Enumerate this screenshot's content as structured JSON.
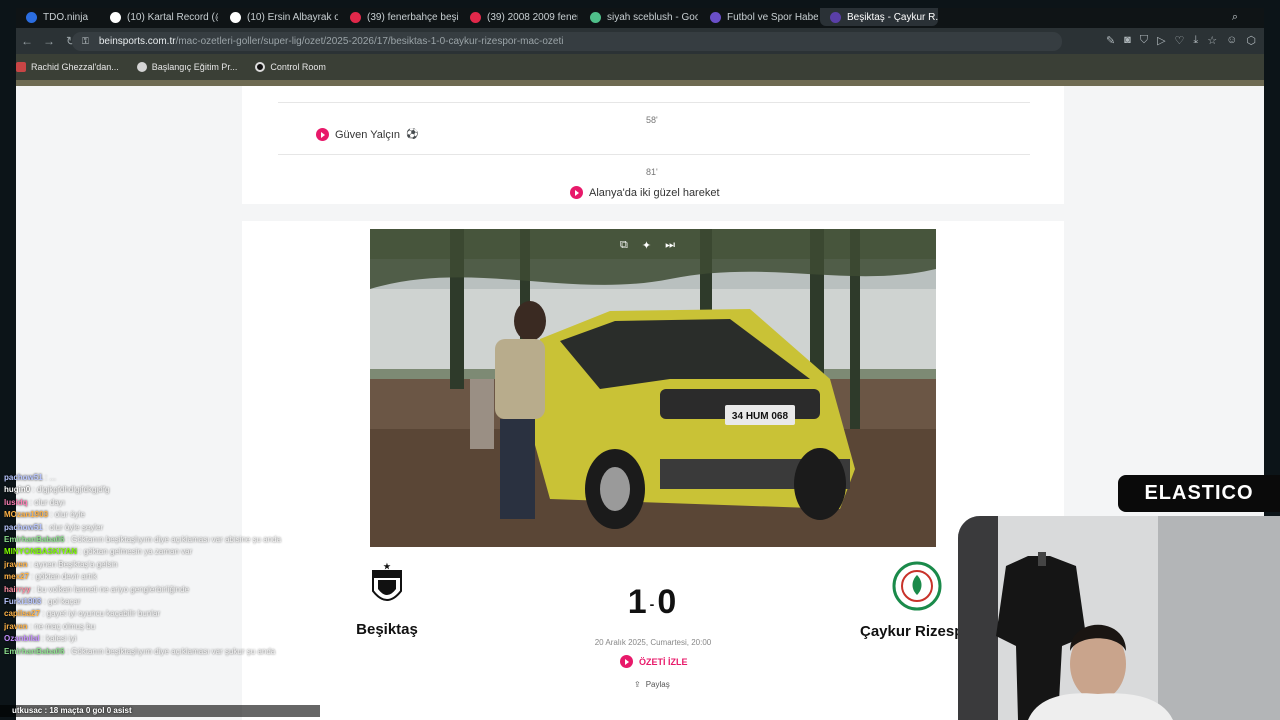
{
  "browser": {
    "tabs": [
      {
        "label": "TDO.ninja",
        "color": "#2b6de0",
        "active": false
      },
      {
        "label": "(10) Kartal Record (@K...",
        "color": "#ffffff",
        "active": false
      },
      {
        "label": "(10) Ersin Albayrak on X",
        "color": "#ffffff",
        "active": false
      },
      {
        "label": "(39) fenerbahçe beşikt...",
        "color": "#e0284a",
        "active": false
      },
      {
        "label": "(39) 2008 2009 fenerb...",
        "color": "#e0284a",
        "active": false
      },
      {
        "label": "siyah sceblush - Google",
        "color": "#4fbf8a",
        "active": false
      },
      {
        "label": "Futbol ve Spor Haberle...",
        "color": "#6a4fc8",
        "active": false
      },
      {
        "label": "Beşiktaş - Çaykur R...",
        "color": "#5a3fa8",
        "active": true
      }
    ],
    "url_host": "beinsports.com.tr",
    "url_path": "/mac-ozetleri-goller/super-lig/ozet/2025-2026/17/besiktas-1-0-caykur-rizespor-mac-ozeti",
    "bookmarks": [
      "Rachid Ghezzal'dan...",
      "Başlangıç Eğitim Pr...",
      "Control Room"
    ]
  },
  "events": [
    {
      "minute": "58'",
      "text": "Güven Yalçın",
      "goal": "⚽"
    },
    {
      "minute": "81'",
      "text": "Alanya'da iki güzel hareket"
    }
  ],
  "video": {
    "plate": "34 HUM 068"
  },
  "match": {
    "home": "Beşiktaş",
    "away": "Çaykur Rizesp",
    "score_home": "1",
    "score_away": "0",
    "date": "20 Aralık 2025, Cumartesi, 20:00",
    "watch_label": "ÖZETİ İZLE",
    "share_label": "Paylaş"
  },
  "chat": [
    {
      "user": "pachow51",
      "msg": ": ...",
      "color": "#b9c6ff"
    },
    {
      "user": "hugin0",
      "msg": ": dlgjkgfdhdlgjfdkgjdfg",
      "color": "#ffffff"
    },
    {
      "user": "lusidq",
      "msg": ": olur dayı",
      "color": "#ff7fb5"
    },
    {
      "user": "MOzan1903",
      "msg": ": olur öyle",
      "color": "#ffb347"
    },
    {
      "user": "pachow51",
      "msg": ": olur öyle şeyler",
      "color": "#b9c6ff"
    },
    {
      "user": "EmirhanBaba06",
      "msg": ": Göktanın beşiktaşlıyım diye açıklaması var abisine şu anda",
      "color": "#8ee08e"
    },
    {
      "user": "MINYONBASKIYAN",
      "msg": ": göktan gelmesin ya zaman var",
      "color": "#7fff00"
    },
    {
      "user": "jraven",
      "msg": ": aynen Beşiktaş'a gelsin",
      "color": "#ffb347"
    },
    {
      "user": "mex27",
      "msg": ": göktan devir artık",
      "color": "#ffb347"
    },
    {
      "user": "hairryy",
      "msg": ": bu volkan lanneti ne ariyo genglerbirliğinde",
      "color": "#ff8fa3"
    },
    {
      "user": "Furki1903",
      "msg": ": gol kaçar",
      "color": "#b9c6ff"
    },
    {
      "user": "capilsa27",
      "msg": ": gayet iyi oyuncu kaçabilir bunlar",
      "color": "#ffb347"
    },
    {
      "user": "jraven",
      "msg": ": ne maç olmuş bu",
      "color": "#ffb347"
    },
    {
      "user": "Ozanbilal",
      "msg": ": kalesi iyi",
      "color": "#c58fff"
    },
    {
      "user": "EmirhanBaba06",
      "msg": ": Göktanın beşiktaşlıyım diye açıklaması var şukur şu anda",
      "color": "#8ee08e"
    }
  ],
  "chat_last": "utkusac : 18 maçta 0 gol 0 asist",
  "brand": "ELASTICO"
}
